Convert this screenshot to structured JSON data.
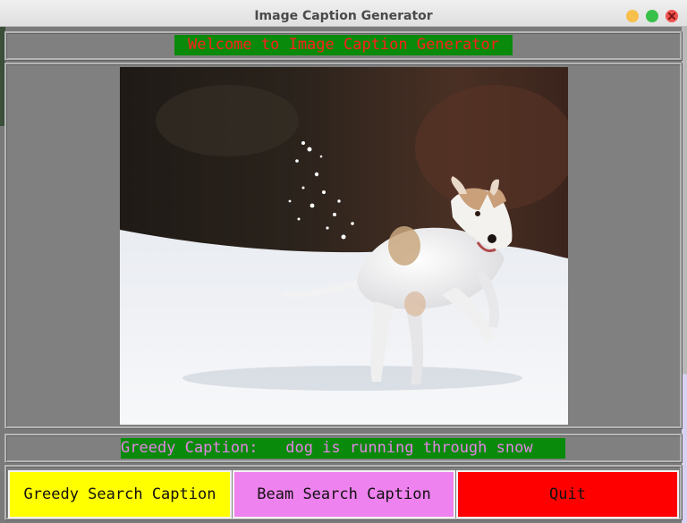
{
  "window": {
    "title": "Image Caption Generator"
  },
  "header": {
    "welcome_text": "Welcome to Image Caption Generator"
  },
  "caption": {
    "text": "Greedy Caption:   dog is running through snow"
  },
  "buttons": {
    "greedy_label": "Greedy Search Caption",
    "beam_label": "Beam Search Caption",
    "quit_label": "Quit"
  },
  "colors": {
    "welcome_bg": "#0a8a0a",
    "welcome_fg": "#ff1f1f",
    "caption_fg": "#e384e6",
    "greedy_bg": "#ffff00",
    "beam_bg": "#ee82ee",
    "quit_bg": "#ff0000"
  }
}
